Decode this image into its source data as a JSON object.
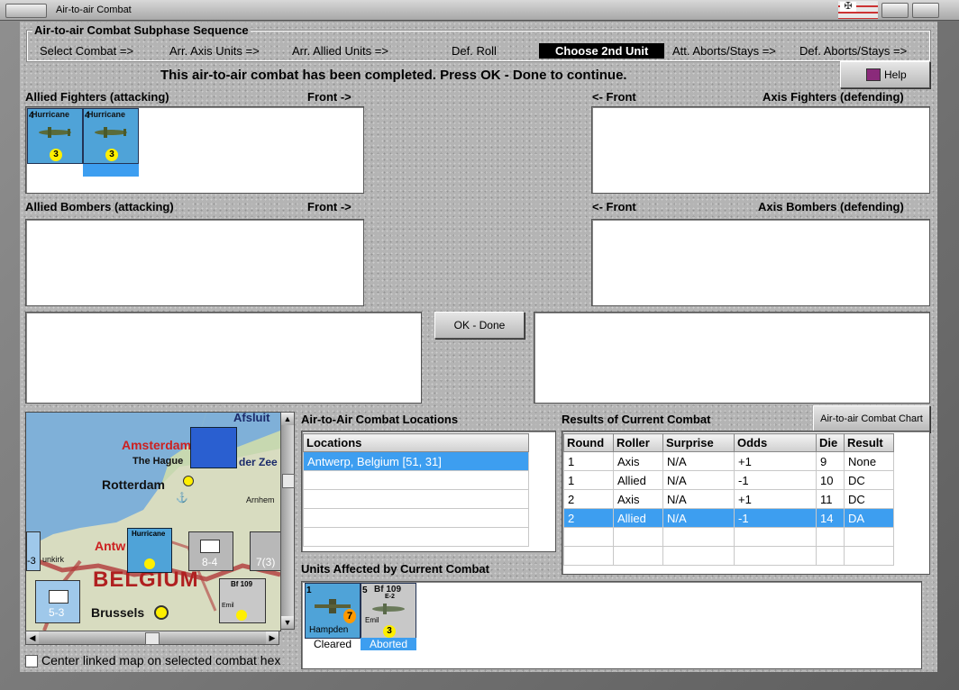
{
  "window": {
    "title": "Air-to-air Combat"
  },
  "sequence": {
    "title": "Air-to-air Combat Subphase Sequence",
    "steps": [
      {
        "label": "Select Combat =>"
      },
      {
        "label": "Arr. Axis Units =>"
      },
      {
        "label": "Arr. Allied Units  =>"
      },
      {
        "label": "Def. Roll"
      },
      {
        "label": "Choose 2nd Unit"
      },
      {
        "label": "Att. Aborts/Stays =>"
      },
      {
        "label": "Def. Aborts/Stays =>"
      }
    ],
    "active_step": "Choose 2nd Unit"
  },
  "message": "This air-to-air combat has been completed.  Press OK - Done to continue.",
  "help_label": "Help",
  "sections": {
    "allied_fighters": "Allied Fighters (attacking)",
    "allied_bombers": "Allied Bombers (attacking)",
    "axis_fighters": "Axis Fighters (defending)",
    "axis_bombers": "Axis Bombers (defending)",
    "front_right": "Front ->",
    "front_left": "<- Front"
  },
  "allied_fighter_units": [
    {
      "name": "Hurricane",
      "strength": "4",
      "rating": "3"
    },
    {
      "name": "Hurricane",
      "strength": "4",
      "rating": "3"
    }
  ],
  "ok_done_label": "OK - Done",
  "map": {
    "labels": {
      "amsterdam": "Amsterdam",
      "the_hague": "The Hague",
      "rotterdam": "Rotterdam",
      "arnhem": "Arnhem",
      "afsluit": "Afsluit",
      "zuider_zee": "der Zee",
      "antwerp": "Antw",
      "belgium": "BELGIUM",
      "brussels": "Brussels",
      "dunkirk": "unkirk"
    },
    "counters": {
      "hurricane": "Hurricane",
      "bf109": "Bf 109",
      "bf109_variant": "E-2",
      "emil": "Emil",
      "unit_value": "8-4",
      "unit_value2": "5-3",
      "unit_value3": "7(3)",
      "unit_value4": "-3"
    }
  },
  "center_map_label": "Center linked map on selected combat hex",
  "locations": {
    "title": "Air-to-Air Combat Locations",
    "header": "Locations",
    "rows": [
      "Antwerp, Belgium [51, 31]",
      "",
      "",
      "",
      ""
    ]
  },
  "results": {
    "title": "Results of Current Combat",
    "chart_button": "Air-to-air Combat Chart",
    "columns": [
      "Round",
      "Roller",
      "Surprise",
      "Odds",
      "Die",
      "Result"
    ],
    "rows": [
      [
        "1",
        "Axis",
        "N/A",
        "+1",
        "9",
        "None"
      ],
      [
        "1",
        "Allied",
        "N/A",
        "-1",
        "10",
        "DC"
      ],
      [
        "2",
        "Axis",
        "N/A",
        "+1",
        "11",
        "DC"
      ],
      [
        "2",
        "Allied",
        "N/A",
        "-1",
        "14",
        "DA"
      ],
      [
        "",
        "",
        "",
        "",
        "",
        ""
      ],
      [
        "",
        "",
        "",
        "",
        "",
        ""
      ]
    ]
  },
  "affected": {
    "title": "Units Affected by Current Combat",
    "units": [
      {
        "name": "Hampden",
        "strength": "1",
        "rating": "7",
        "status": "Cleared"
      },
      {
        "name": "Bf 109",
        "variant": "E-2",
        "nickname": "Emil",
        "strength": "5",
        "rating": "3",
        "status": "Aborted"
      }
    ]
  },
  "colors": {
    "selection": "#3d9ef0",
    "allied_counter": "#4fa3d8",
    "axis_counter": "#c8c8c8",
    "active_step_bg": "#000000"
  }
}
